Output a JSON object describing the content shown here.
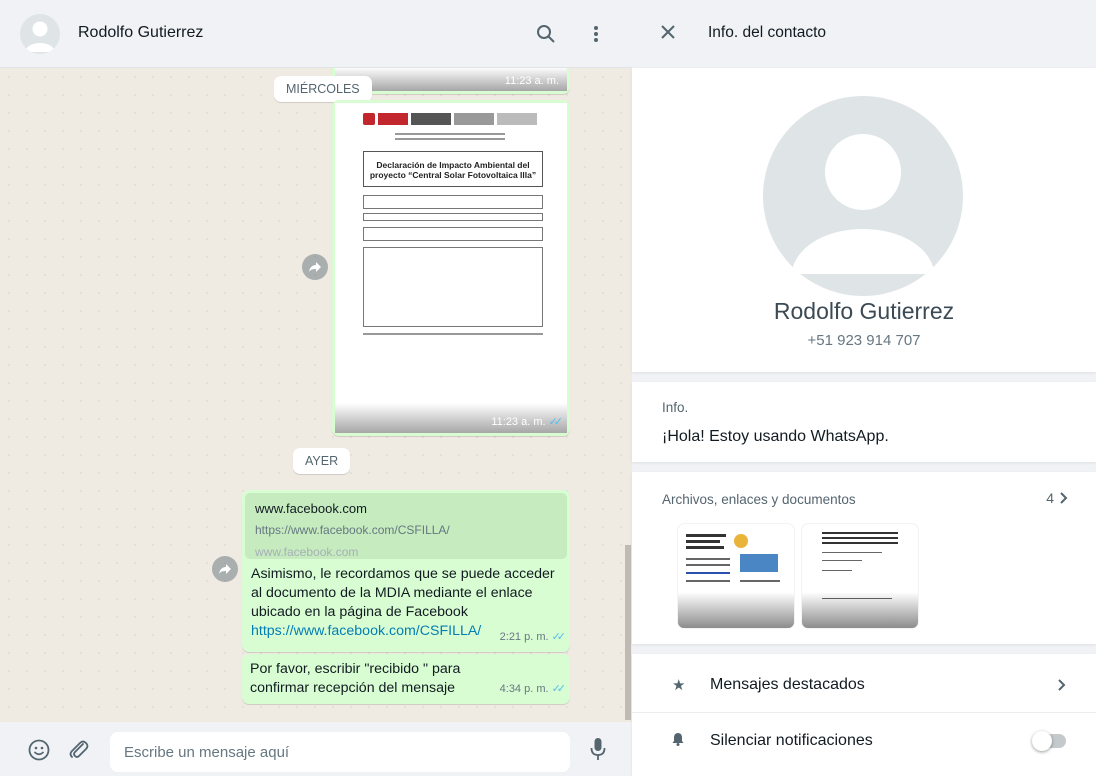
{
  "chat": {
    "contact_name": "Rodolfo Gutierrez",
    "search_icon": "search-icon",
    "menu_icon": "menu-icon",
    "dates": {
      "wednesday": "MIÉRCOLES",
      "yesterday": "AYER"
    },
    "doc_message": {
      "time": "11:23 a. m.",
      "top_time": "11:23 a. m.",
      "doc_title_line1": "Declaración de Impacto Ambiental del",
      "doc_title_line2": "proyecto “Central Solar Fotovoltaica Illa”"
    },
    "link_message": {
      "preview_title": "www.facebook.com",
      "preview_url": "https://www.facebook.com/CSFILLA/",
      "preview_domain": "www.facebook.com",
      "text": "Asimismo, le recordamos que se puede acceder al documento de la MDIA mediante el enlace ubicado en la página de Facebook",
      "link": "https://www.facebook.com/CSFILLA/",
      "time": "2:21 p. m."
    },
    "last_message": {
      "text": "Por favor, escribir \"recibido \" para confirmar recepción del mensaje",
      "time": "4:34 p. m."
    },
    "input_placeholder": "Escribe un mensaje aquí"
  },
  "info": {
    "title": "Info. del contacto",
    "name": "Rodolfo Gutierrez",
    "phone": "+51 923 914 707",
    "about_label": "Info.",
    "about_text": "¡Hola! Estoy usando WhatsApp.",
    "media_label": "Archivos, enlaces y documentos",
    "media_count": "4",
    "starred": "Mensajes destacados",
    "mute": "Silenciar notificaciones"
  },
  "colors": {
    "bubble": "#d9fdd3",
    "chat_bg": "#efeae2",
    "tick": "#53bdeb",
    "link": "#027eb5"
  }
}
